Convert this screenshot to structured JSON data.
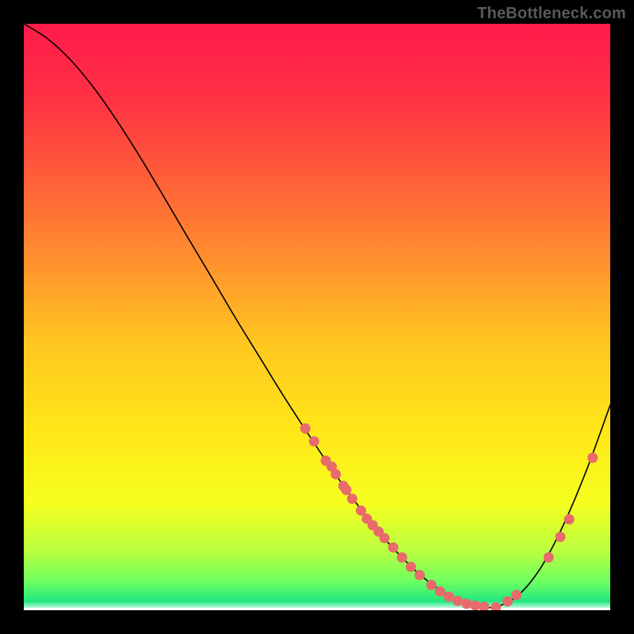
{
  "watermark": "TheBottleneck.com",
  "chart_data": {
    "type": "line",
    "title": "",
    "xlabel": "",
    "ylabel": "",
    "xlim": [
      0,
      100
    ],
    "ylim": [
      0,
      100
    ],
    "background_gradient": {
      "stops": [
        {
          "offset": 0.0,
          "color": "#ff1a4a"
        },
        {
          "offset": 0.12,
          "color": "#ff3044"
        },
        {
          "offset": 0.25,
          "color": "#ff5a3a"
        },
        {
          "offset": 0.4,
          "color": "#ff8f2e"
        },
        {
          "offset": 0.55,
          "color": "#ffc820"
        },
        {
          "offset": 0.7,
          "color": "#ffe818"
        },
        {
          "offset": 0.82,
          "color": "#f5ff20"
        },
        {
          "offset": 0.9,
          "color": "#b8ff40"
        },
        {
          "offset": 0.95,
          "color": "#70ff60"
        },
        {
          "offset": 0.985,
          "color": "#20e880"
        },
        {
          "offset": 1.0,
          "color": "#ffffff"
        }
      ]
    },
    "series": [
      {
        "name": "curve",
        "x": [
          0,
          4,
          8,
          12,
          16,
          20,
          24,
          28,
          32,
          36,
          40,
          44,
          48,
          52,
          56,
          60,
          64,
          68,
          72,
          76,
          80,
          84,
          88,
          92,
          96,
          100
        ],
        "y": [
          100,
          97.5,
          93.8,
          89.0,
          83.3,
          77.0,
          70.3,
          63.5,
          56.8,
          50.0,
          43.5,
          37.0,
          30.8,
          24.8,
          19.2,
          14.0,
          9.5,
          5.7,
          2.8,
          1.0,
          0.5,
          2.3,
          7.0,
          14.5,
          24.0,
          35.0
        ],
        "stroke": "#000000",
        "stroke_width": 1.6
      }
    ],
    "points": {
      "color": "#e86a6a",
      "radius": 6.5,
      "data": [
        {
          "x": 48.0,
          "y": 31.0
        },
        {
          "x": 49.5,
          "y": 28.8
        },
        {
          "x": 51.5,
          "y": 25.5
        },
        {
          "x": 52.5,
          "y": 24.5
        },
        {
          "x": 53.2,
          "y": 23.2
        },
        {
          "x": 54.5,
          "y": 21.2
        },
        {
          "x": 55.0,
          "y": 20.5
        },
        {
          "x": 56.0,
          "y": 19.0
        },
        {
          "x": 57.5,
          "y": 17.0
        },
        {
          "x": 58.5,
          "y": 15.6
        },
        {
          "x": 59.5,
          "y": 14.5
        },
        {
          "x": 60.5,
          "y": 13.4
        },
        {
          "x": 61.5,
          "y": 12.3
        },
        {
          "x": 63.0,
          "y": 10.7
        },
        {
          "x": 64.5,
          "y": 9.0
        },
        {
          "x": 66.0,
          "y": 7.4
        },
        {
          "x": 67.5,
          "y": 6.0
        },
        {
          "x": 69.5,
          "y": 4.3
        },
        {
          "x": 71.0,
          "y": 3.2
        },
        {
          "x": 72.5,
          "y": 2.3
        },
        {
          "x": 74.0,
          "y": 1.6
        },
        {
          "x": 75.5,
          "y": 1.1
        },
        {
          "x": 77.0,
          "y": 0.8
        },
        {
          "x": 78.5,
          "y": 0.6
        },
        {
          "x": 80.5,
          "y": 0.5
        },
        {
          "x": 82.5,
          "y": 1.5
        },
        {
          "x": 84.0,
          "y": 2.6
        },
        {
          "x": 89.5,
          "y": 9.0
        },
        {
          "x": 91.5,
          "y": 12.5
        },
        {
          "x": 93.0,
          "y": 15.5
        },
        {
          "x": 97.0,
          "y": 26.0
        }
      ]
    }
  }
}
